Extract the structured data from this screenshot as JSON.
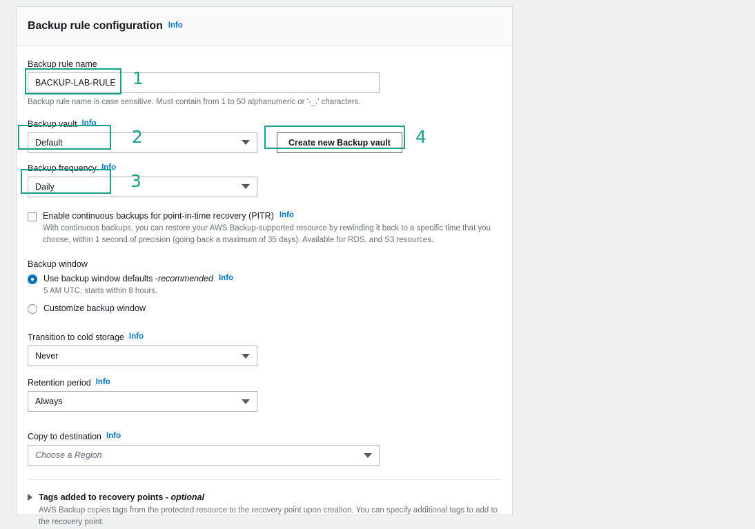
{
  "panel": {
    "title": "Backup rule configuration",
    "info_label": "Info"
  },
  "rule_name": {
    "label": "Backup rule name",
    "value": "BACKUP-LAB-RULE",
    "helper": "Backup rule name is case sensitive. Must contain from 1 to 50 alphanumeric or '-_.' characters."
  },
  "backup_vault": {
    "label": "Backup vault",
    "info_label": "Info",
    "value": "Default",
    "create_button": "Create new Backup vault"
  },
  "backup_frequency": {
    "label": "Backup frequency",
    "info_label": "Info",
    "value": "Daily"
  },
  "pitr": {
    "label": "Enable continuous backups for point-in-time recovery (PITR)",
    "info_label": "Info",
    "checked": false,
    "description": "With continuous backups, you can restore your AWS Backup-supported resource by rewinding it back to a specific time that you choose, within 1 second of precision (going back a maximum of 35 days). Available for RDS, and S3 resources."
  },
  "backup_window": {
    "label": "Backup window",
    "info_label": "Info",
    "option_default_prefix": "Use backup window defaults - ",
    "option_default_emphasis": "recommended",
    "option_default_sub": "5 AM UTC, starts within 8 hours.",
    "option_custom": "Customize backup window",
    "selected": "defaults"
  },
  "cold_storage": {
    "label": "Transition to cold storage",
    "info_label": "Info",
    "value": "Never"
  },
  "retention": {
    "label": "Retention period",
    "info_label": "Info",
    "value": "Always"
  },
  "copy_destination": {
    "label": "Copy to destination",
    "info_label": "Info",
    "placeholder": "Choose a Region"
  },
  "tags": {
    "title_prefix": "Tags added to recovery points - ",
    "title_emphasis": "optional",
    "description": "AWS Backup copies tags from the protected resource to the recovery point upon creation. You can specify additional tags to add to the recovery point."
  },
  "annotations": {
    "one": "1",
    "two": "2",
    "three": "3",
    "four": "4",
    "color": "#16a085"
  }
}
